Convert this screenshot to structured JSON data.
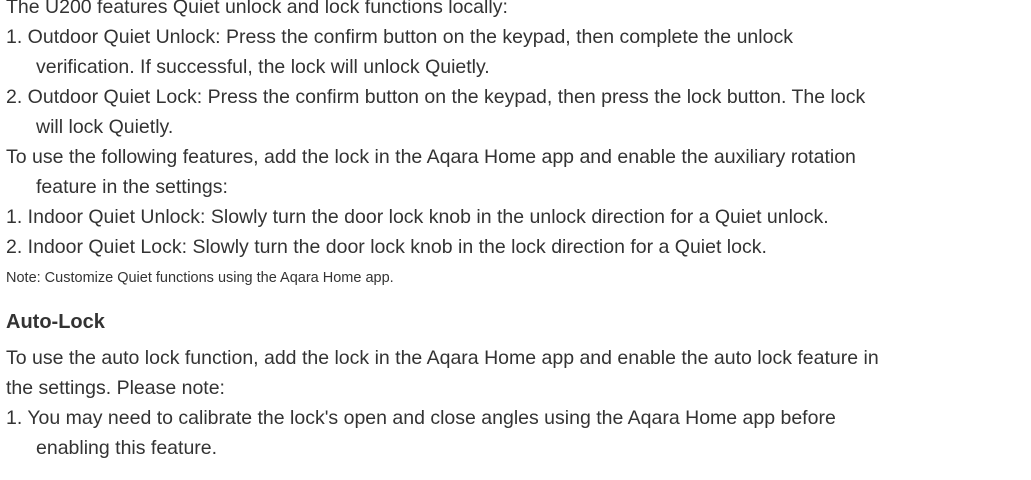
{
  "quiet_section": {
    "intro": "The U200 features Quiet unlock and lock functions locally:",
    "outdoor_unlock_line1": "1. Outdoor Quiet Unlock: Press the confirm button on the keypad, then complete the unlock",
    "outdoor_unlock_line2": "verification. If successful, the lock will unlock Quietly.",
    "outdoor_lock_line1": "2. Outdoor Quiet Lock: Press the confirm button on the keypad, then press the lock button. The lock",
    "outdoor_lock_line2": "will lock Quietly.",
    "app_intro_line1": "To use the following features, add the lock in the Aqara Home app and enable the auxiliary rotation",
    "app_intro_line2": "feature in the settings:",
    "indoor_unlock": "1. Indoor Quiet Unlock: Slowly turn the door lock knob in the unlock direction for a Quiet unlock.",
    "indoor_lock": "2. Indoor Quiet Lock: Slowly turn the door lock knob in the lock direction for a Quiet lock.",
    "note": "Note: Customize Quiet functions using the Aqara Home app."
  },
  "auto_lock_section": {
    "heading": "Auto-Lock",
    "intro_line1": "To use the auto lock function, add the lock in the Aqara Home app and enable the auto lock feature in",
    "intro_line2": "the settings. Please note:",
    "item1_line1": "1. You may need to calibrate the lock's open and close angles using the Aqara Home app before",
    "item1_line2": "enabling this feature."
  }
}
